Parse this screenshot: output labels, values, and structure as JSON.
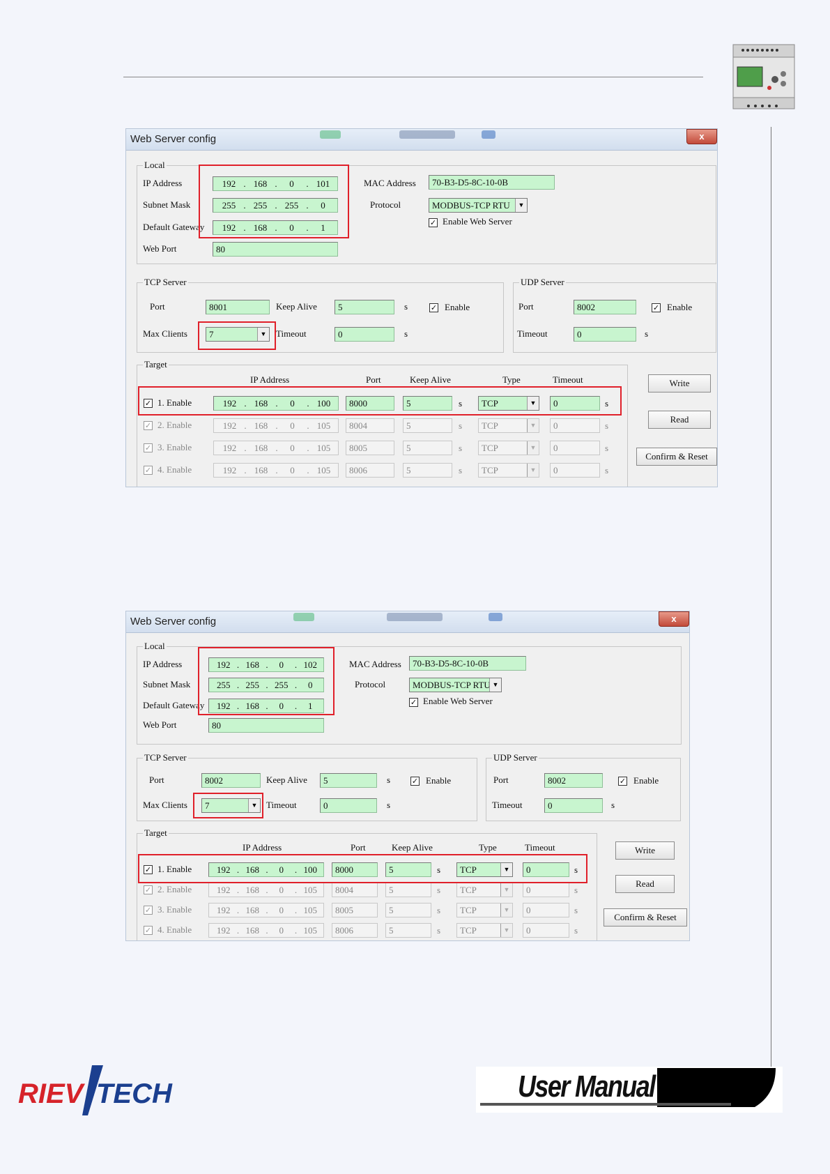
{
  "window_title": "Web Server config",
  "close_glyph": "x",
  "check_glyph": "✓",
  "arrow_glyph": "▼",
  "labels": {
    "local": "Local",
    "ip_address": "IP Address",
    "subnet_mask": "Subnet Mask",
    "default_gateway": "Default Gateway",
    "web_port": "Web Port",
    "mac_address": "MAC Address",
    "protocol": "Protocol",
    "enable_web_server": "Enable Web Server",
    "tcp_server": "TCP Server",
    "udp_server": "UDP Server",
    "port": "Port",
    "keep_alive": "Keep Alive",
    "max_clients": "Max Clients",
    "timeout": "Timeout",
    "enable": "Enable",
    "unit_s": "s",
    "target": "Target",
    "type": "Type"
  },
  "buttons": {
    "write": "Write",
    "read": "Read",
    "confirm_reset": "Confirm & Reset"
  },
  "footer": {
    "brand": "RIEVTECH",
    "manual": "User Manual"
  },
  "dialogs": [
    {
      "local": {
        "ip": [
          "192",
          "168",
          "0",
          "101"
        ],
        "mask": [
          "255",
          "255",
          "255",
          "0"
        ],
        "gateway": [
          "192",
          "168",
          "0",
          "1"
        ],
        "web_port": "80",
        "mac": "70-B3-D5-8C-10-0B",
        "protocol": "MODBUS-TCP RTU",
        "enable_web_server": true
      },
      "tcp": {
        "port": "8001",
        "keep_alive": "5",
        "enable": true,
        "max_clients": "7",
        "timeout": "0"
      },
      "udp": {
        "port": "8002",
        "enable": true,
        "timeout": "0"
      },
      "targets": [
        {
          "label": "1. Enable",
          "ip": [
            "192",
            "168",
            "0",
            "100"
          ],
          "port": "8000",
          "keep_alive": "5",
          "type": "TCP",
          "timeout": "0",
          "active": true
        },
        {
          "label": "2. Enable",
          "ip": [
            "192",
            "168",
            "0",
            "105"
          ],
          "port": "8004",
          "keep_alive": "5",
          "type": "TCP",
          "timeout": "0",
          "active": false
        },
        {
          "label": "3. Enable",
          "ip": [
            "192",
            "168",
            "0",
            "105"
          ],
          "port": "8005",
          "keep_alive": "5",
          "type": "TCP",
          "timeout": "0",
          "active": false
        },
        {
          "label": "4. Enable",
          "ip": [
            "192",
            "168",
            "0",
            "105"
          ],
          "port": "8006",
          "keep_alive": "5",
          "type": "TCP",
          "timeout": "0",
          "active": false
        }
      ]
    },
    {
      "local": {
        "ip": [
          "192",
          "168",
          "0",
          "102"
        ],
        "mask": [
          "255",
          "255",
          "255",
          "0"
        ],
        "gateway": [
          "192",
          "168",
          "0",
          "1"
        ],
        "web_port": "80",
        "mac": "70-B3-D5-8C-10-0B",
        "protocol": "MODBUS-TCP RTU",
        "enable_web_server": true
      },
      "tcp": {
        "port": "8002",
        "keep_alive": "5",
        "enable": true,
        "max_clients": "7",
        "timeout": "0"
      },
      "udp": {
        "port": "8002",
        "enable": true,
        "timeout": "0"
      },
      "targets": [
        {
          "label": "1. Enable",
          "ip": [
            "192",
            "168",
            "0",
            "100"
          ],
          "port": "8000",
          "keep_alive": "5",
          "type": "TCP",
          "timeout": "0",
          "active": true
        },
        {
          "label": "2. Enable",
          "ip": [
            "192",
            "168",
            "0",
            "105"
          ],
          "port": "8004",
          "keep_alive": "5",
          "type": "TCP",
          "timeout": "0",
          "active": false
        },
        {
          "label": "3. Enable",
          "ip": [
            "192",
            "168",
            "0",
            "105"
          ],
          "port": "8005",
          "keep_alive": "5",
          "type": "TCP",
          "timeout": "0",
          "active": false
        },
        {
          "label": "4. Enable",
          "ip": [
            "192",
            "168",
            "0",
            "105"
          ],
          "port": "8006",
          "keep_alive": "5",
          "type": "TCP",
          "timeout": "0",
          "active": false
        }
      ]
    }
  ]
}
